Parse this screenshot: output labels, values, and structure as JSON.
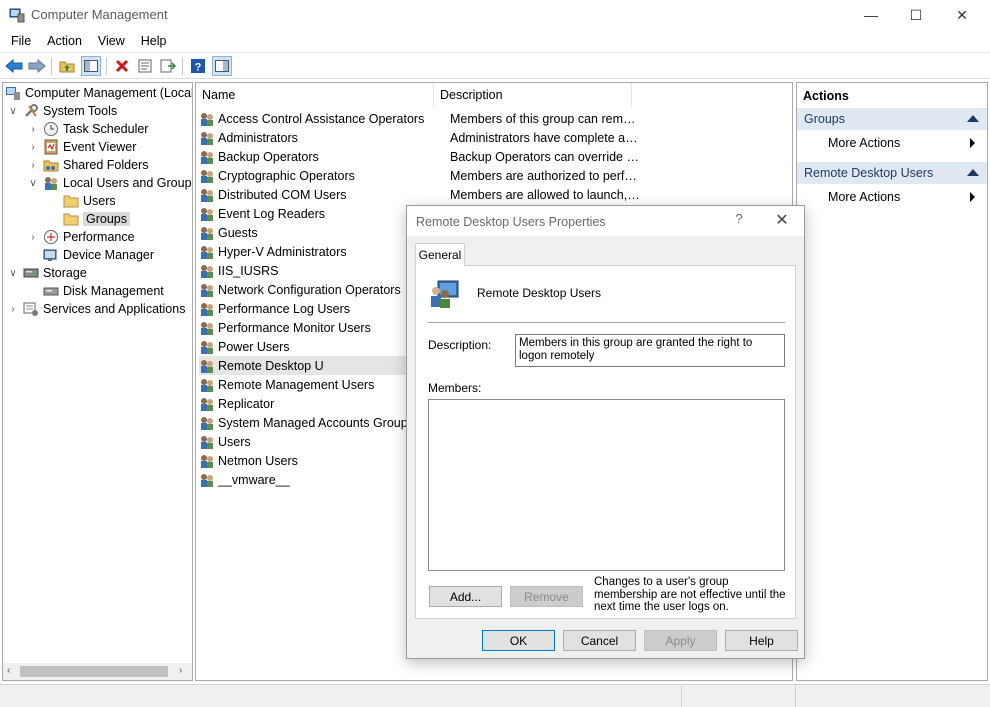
{
  "window": {
    "title": "Computer Management",
    "controls": {
      "minimize": "—",
      "maximize": "☐",
      "close": "✕"
    }
  },
  "menu": [
    "File",
    "Action",
    "View",
    "Help"
  ],
  "toolbar": [
    "back-icon",
    "forward-icon",
    "up-folder-icon",
    "show-hide-tree-icon",
    "delete-icon",
    "properties-icon",
    "export-list-icon",
    "help-icon",
    "show-action-pane-icon"
  ],
  "tree": {
    "items": [
      {
        "label": "Computer Management (Local",
        "icon": "computer-icon"
      },
      {
        "label": "System Tools",
        "icon": "tools-icon"
      },
      {
        "label": "Task Scheduler",
        "icon": "clock-icon"
      },
      {
        "label": "Event Viewer",
        "icon": "event-viewer-icon"
      },
      {
        "label": "Shared Folders",
        "icon": "shared-folder-icon"
      },
      {
        "label": "Local Users and Groups",
        "icon": "users-icon"
      },
      {
        "label": "Users",
        "icon": "folder-icon"
      },
      {
        "label": "Groups",
        "icon": "folder-icon"
      },
      {
        "label": "Performance",
        "icon": "performance-icon"
      },
      {
        "label": "Device Manager",
        "icon": "device-manager-icon"
      },
      {
        "label": "Storage",
        "icon": "storage-icon"
      },
      {
        "label": "Disk Management",
        "icon": "disk-icon"
      },
      {
        "label": "Services and Applications",
        "icon": "services-icon"
      }
    ]
  },
  "list": {
    "columns": {
      "name": "Name",
      "description": "Description"
    },
    "rows": [
      {
        "name": "Access Control Assistance Operators",
        "description": "Members of this group can remot..."
      },
      {
        "name": "Administrators",
        "description": "Administrators have complete an..."
      },
      {
        "name": "Backup Operators",
        "description": "Backup Operators can override se..."
      },
      {
        "name": "Cryptographic Operators",
        "description": "Members are authorized to perfor..."
      },
      {
        "name": "Distributed COM Users",
        "description": "Members are allowed to launch, a..."
      },
      {
        "name": "Event Log Readers",
        "description": ""
      },
      {
        "name": "Guests",
        "description": ""
      },
      {
        "name": "Hyper-V Administrators",
        "description": ""
      },
      {
        "name": "IIS_IUSRS",
        "description": ""
      },
      {
        "name": "Network Configuration Operators",
        "description": ""
      },
      {
        "name": "Performance Log Users",
        "description": ""
      },
      {
        "name": "Performance Monitor Users",
        "description": ""
      },
      {
        "name": "Power Users",
        "description": ""
      },
      {
        "name": "Remote Desktop Users",
        "description": ""
      },
      {
        "name": "Remote Management Users",
        "description": ""
      },
      {
        "name": "Replicator",
        "description": ""
      },
      {
        "name": "System Managed Accounts Group",
        "description": ""
      },
      {
        "name": "Users",
        "description": ""
      },
      {
        "name": "Netmon Users",
        "description": ""
      },
      {
        "name": "__vmware__",
        "description": ""
      }
    ]
  },
  "actions": {
    "header": "Actions",
    "groups": [
      {
        "title": "Groups",
        "items": [
          "More Actions"
        ]
      },
      {
        "title": "Remote Desktop Users",
        "items": [
          "More Actions"
        ]
      }
    ]
  },
  "dialog": {
    "title": "Remote Desktop Users Properties",
    "help": "?",
    "close": "✕",
    "tab": "General",
    "group_name": "Remote Desktop Users",
    "description_label": "Description:",
    "description_value": "Members in this group are granted the right to logon remotely",
    "members_label": "Members:",
    "add_button": "Add...",
    "remove_button": "Remove",
    "note": "Changes to a user's group membership are not effective until the next time the user logs on.",
    "ok_button": "OK",
    "cancel_button": "Cancel",
    "apply_button": "Apply",
    "help_button": "Help"
  }
}
